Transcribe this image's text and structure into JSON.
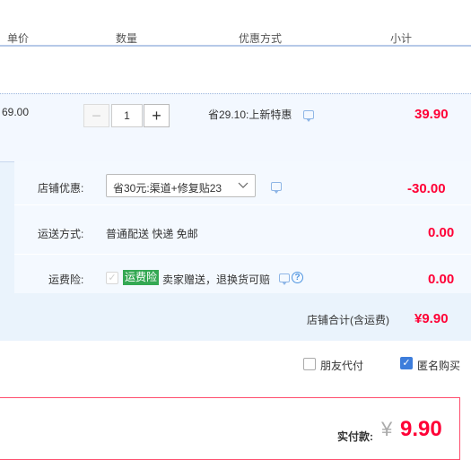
{
  "header": {
    "unit_price": "单价",
    "quantity": "数量",
    "discount_method": "优惠方式",
    "subtotal": "小计"
  },
  "item": {
    "unit_price": "69.00",
    "quantity": "1",
    "minus": "−",
    "plus": "+",
    "promo": "省29.10:上新特惠",
    "subtotal": "39.90"
  },
  "shop": {
    "discount_label": "店铺优惠:",
    "discount_selected": "省30元:渠道+修复贴23",
    "discount_amount": "-30.00",
    "delivery_label": "运送方式:",
    "delivery_value": "普通配送 快递 免邮",
    "delivery_amount": "0.00",
    "insurance_label": "运费险:",
    "insurance_badge": "运费险",
    "insurance_text": "卖家赠送，退换货可赔",
    "insurance_amount": "0.00",
    "total_label": "店铺合计(含运费)",
    "total_value": "¥9.90"
  },
  "options": {
    "friend_pay": "朋友代付",
    "anonymous": "匿名购买"
  },
  "payment": {
    "label": "实付款:",
    "currency": "¥",
    "amount": "9.90"
  },
  "colors": {
    "price_red": "#ff0036",
    "accent_blue": "#3d7ddb",
    "badge_green": "#34a853"
  },
  "icons": [
    "chat-bubble-icon",
    "help-icon",
    "chevron-down-icon",
    "check-icon"
  ]
}
